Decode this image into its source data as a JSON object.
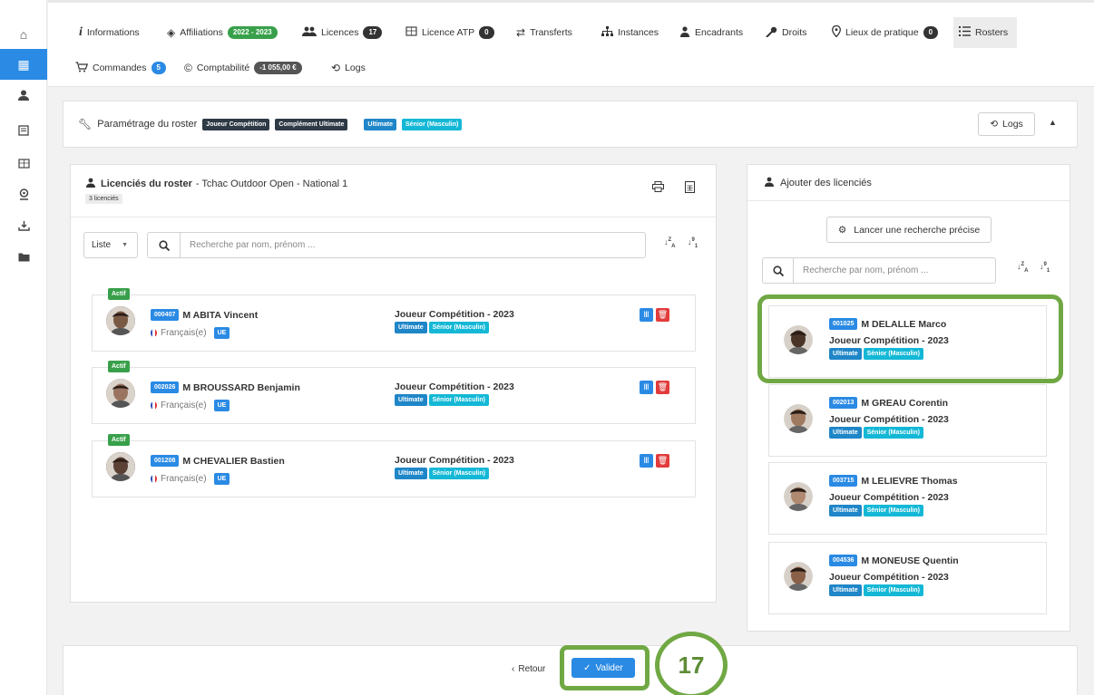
{
  "sidebar": {
    "items": [
      {
        "icon": "home-icon",
        "glyph": "⌂"
      },
      {
        "icon": "building-icon",
        "glyph": "▦",
        "active": true
      },
      {
        "icon": "users-icon",
        "glyph": "👥"
      },
      {
        "icon": "document-icon",
        "glyph": "▤"
      },
      {
        "icon": "flag-icon",
        "glyph": "⚑"
      },
      {
        "icon": "location-icon",
        "glyph": "◎"
      },
      {
        "icon": "download-icon",
        "glyph": "⤓"
      },
      {
        "icon": "folder-icon",
        "glyph": "■"
      }
    ]
  },
  "tabs": {
    "informations": {
      "label": "Informations",
      "icon": "info-icon"
    },
    "affiliations": {
      "label": "Affiliations",
      "badge": "2022 - 2023",
      "icon": "layers-icon"
    },
    "licences": {
      "label": "Licences",
      "badge": "17",
      "icon": "users-icon"
    },
    "licence_atp": {
      "label": "Licence ATP",
      "badge": "0",
      "icon": "flag-icon"
    },
    "transferts": {
      "label": "Transferts",
      "icon": "swap-icon"
    },
    "instances": {
      "label": "Instances",
      "icon": "hierarchy-icon"
    },
    "encadrants": {
      "label": "Encadrants",
      "icon": "coach-icon"
    },
    "droits": {
      "label": "Droits",
      "icon": "key-icon"
    },
    "lieux": {
      "label": "Lieux de pratique",
      "badge": "0",
      "icon": "map-pin-icon"
    },
    "rosters": {
      "label": "Rosters",
      "icon": "list-icon"
    },
    "commandes": {
      "label": "Commandes",
      "badge": "5",
      "icon": "cart-icon"
    },
    "comptabilite": {
      "label": "Comptabilité",
      "badge": "-1 055,00 €",
      "icon": "copyright-icon"
    },
    "logs": {
      "label": "Logs",
      "icon": "history-icon"
    }
  },
  "param": {
    "label": "Paramétrage du roster",
    "tags": [
      "Joueur Compétition",
      "Complément Ultimate",
      "Ultimate",
      "Sénior (Masculin)"
    ],
    "logs_button": "Logs"
  },
  "roster": {
    "title_bold": "Licenciés du roster",
    "title_rest": " - Tchac Outdoor Open - National 1",
    "count": "3 licenciés",
    "view_select": "Liste",
    "search_placeholder": "Recherche par nom, prénom ...",
    "status": "Actif",
    "members": [
      {
        "num": "000407",
        "name": "M ABITA Vincent",
        "nationality": "Français(e)",
        "ue": "UE",
        "licence": "Joueur Compétition - 2023",
        "tag1": "Ultimate",
        "tag2": "Sénior (Masculin)"
      },
      {
        "num": "002026",
        "name": "M BROUSSARD Benjamin",
        "nationality": "Français(e)",
        "ue": "UE",
        "licence": "Joueur Compétition - 2023",
        "tag1": "Ultimate",
        "tag2": "Sénior (Masculin)"
      },
      {
        "num": "001208",
        "name": "M CHEVALIER Bastien",
        "nationality": "Français(e)",
        "ue": "UE",
        "licence": "Joueur Compétition - 2023",
        "tag1": "Ultimate",
        "tag2": "Sénior (Masculin)"
      }
    ]
  },
  "add": {
    "title": "Ajouter des licenciés",
    "search_button": "Lancer une recherche précise",
    "search_placeholder": "Recherche par nom, prénom ...",
    "candidates": [
      {
        "num": "001025",
        "name": "M DELALLE Marco",
        "licence": "Joueur Compétition - 2023",
        "tag1": "Ultimate",
        "tag2": "Sénior (Masculin)"
      },
      {
        "num": "002013",
        "name": "M GREAU Corentin",
        "licence": "Joueur Compétition - 2023",
        "tag1": "Ultimate",
        "tag2": "Sénior (Masculin)"
      },
      {
        "num": "003715",
        "name": "M LELIEVRE Thomas",
        "licence": "Joueur Compétition - 2023",
        "tag1": "Ultimate",
        "tag2": "Sénior (Masculin)"
      },
      {
        "num": "004536",
        "name": "M MONEUSE Quentin",
        "licence": "Joueur Compétition - 2023",
        "tag1": "Ultimate",
        "tag2": "Sénior (Masculin)"
      }
    ]
  },
  "footer": {
    "back": "Retour",
    "validate": "Valider",
    "step": "17"
  },
  "colors": {
    "accent": "#2a8ae4",
    "highlight": "#70a844",
    "danger": "#e23b3b"
  }
}
